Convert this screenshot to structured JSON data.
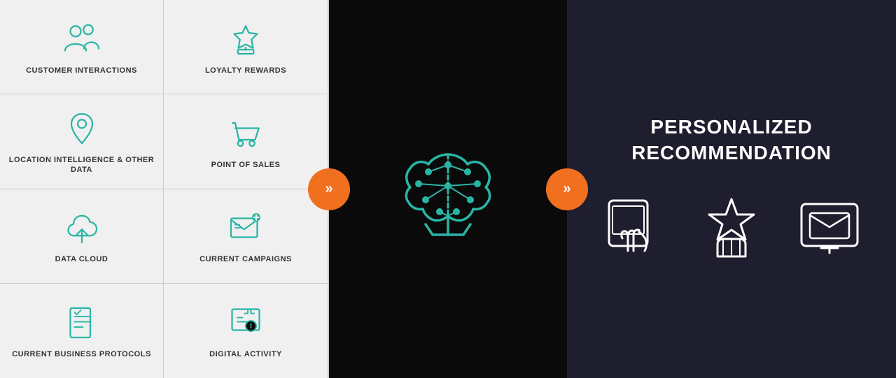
{
  "leftPanel": {
    "cells": [
      {
        "id": "customer-interactions",
        "label": "CUSTOMER\nINTERACTIONS",
        "icon": "people"
      },
      {
        "id": "loyalty-rewards",
        "label": "LOYALTY\nREWARDS",
        "icon": "trophy"
      },
      {
        "id": "location-intelligence",
        "label": "LOCATION INTELLIGENCE\n& OTHER DATA",
        "icon": "location"
      },
      {
        "id": "point-of-sales",
        "label": "POINT OF SALES",
        "icon": "cart"
      },
      {
        "id": "data-cloud",
        "label": "DATA CLOUD",
        "icon": "cloud"
      },
      {
        "id": "current-campaigns",
        "label": "CURRENT\nCAMPAIGNS",
        "icon": "email-tag"
      },
      {
        "id": "current-business-protocols",
        "label": "CURRENT BUSINESS\nPROTOCOLS",
        "icon": "clipboard"
      },
      {
        "id": "digital-activity",
        "label": "DIGITAL\nACTIVITY",
        "icon": "digital"
      }
    ]
  },
  "middlePanel": {
    "label": "AI Brain"
  },
  "arrows": {
    "left": "»",
    "right": "»"
  },
  "rightPanel": {
    "title": "PERSONALIZED\nRECOMMENDATION",
    "icons": [
      "touch-screen",
      "star-hand",
      "email-monitor"
    ]
  }
}
